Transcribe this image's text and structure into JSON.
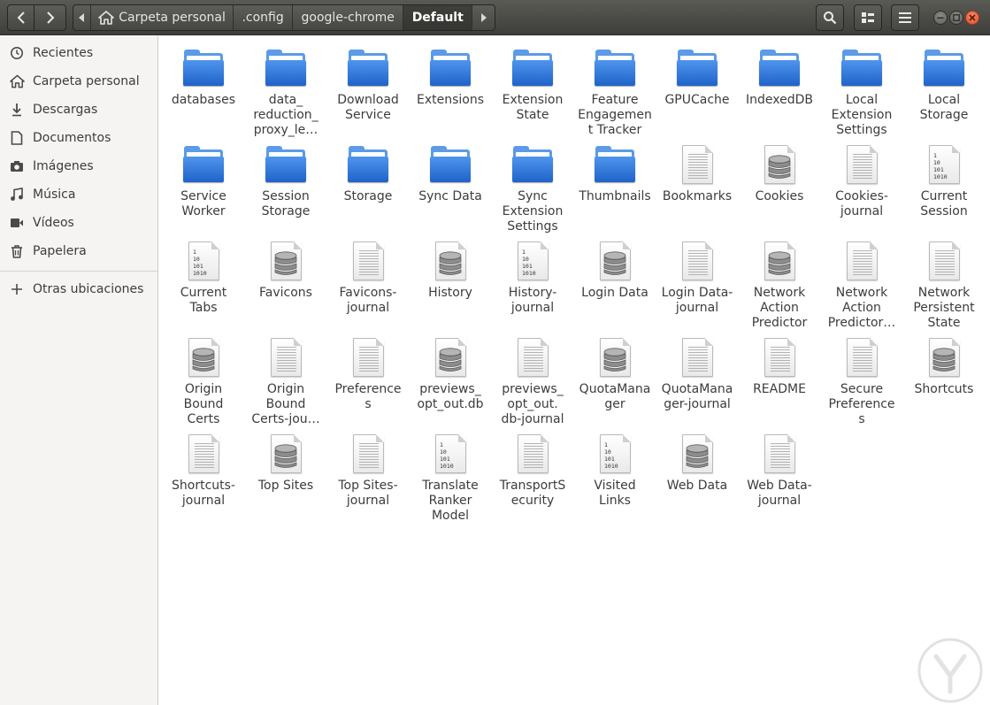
{
  "header": {
    "path": [
      ".config",
      "google-chrome"
    ],
    "home_label": "Carpeta personal",
    "current": "Default"
  },
  "sidebar": {
    "items": [
      {
        "label": "Recientes",
        "icon": "clock-icon"
      },
      {
        "label": "Carpeta personal",
        "icon": "home-icon"
      },
      {
        "label": "Descargas",
        "icon": "download-icon"
      },
      {
        "label": "Documentos",
        "icon": "document-icon"
      },
      {
        "label": "Imágenes",
        "icon": "camera-icon"
      },
      {
        "label": "Música",
        "icon": "music-icon"
      },
      {
        "label": "Vídeos",
        "icon": "film-icon"
      },
      {
        "label": "Papelera",
        "icon": "trash-icon"
      }
    ],
    "other_locations": "Otras ubicaciones"
  },
  "files": [
    {
      "name": "databases",
      "type": "folder"
    },
    {
      "name": "data_\nreduction_\nproxy_le…",
      "type": "folder"
    },
    {
      "name": "Download\nService",
      "type": "folder"
    },
    {
      "name": "Extensions",
      "type": "folder"
    },
    {
      "name": "Extension\nState",
      "type": "folder"
    },
    {
      "name": "Feature\nEngagemen\nt Tracker",
      "type": "folder"
    },
    {
      "name": "GPUCache",
      "type": "folder"
    },
    {
      "name": "IndexedDB",
      "type": "folder"
    },
    {
      "name": "Local\nExtension\nSettings",
      "type": "folder"
    },
    {
      "name": "Local\nStorage",
      "type": "folder"
    },
    {
      "name": "Service\nWorker",
      "type": "folder"
    },
    {
      "name": "Session\nStorage",
      "type": "folder"
    },
    {
      "name": "Storage",
      "type": "folder"
    },
    {
      "name": "Sync Data",
      "type": "folder"
    },
    {
      "name": "Sync\nExtension\nSettings",
      "type": "folder"
    },
    {
      "name": "Thumbnails",
      "type": "folder"
    },
    {
      "name": "Bookmarks",
      "type": "document"
    },
    {
      "name": "Cookies",
      "type": "database"
    },
    {
      "name": "Cookies-\njournal",
      "type": "document"
    },
    {
      "name": "Current\nSession",
      "type": "binary"
    },
    {
      "name": "Current\nTabs",
      "type": "binary"
    },
    {
      "name": "Favicons",
      "type": "database"
    },
    {
      "name": "Favicons-\njournal",
      "type": "document"
    },
    {
      "name": "History",
      "type": "database"
    },
    {
      "name": "History-\njournal",
      "type": "binary"
    },
    {
      "name": "Login Data",
      "type": "database"
    },
    {
      "name": "Login Data-\njournal",
      "type": "document"
    },
    {
      "name": "Network\nAction\nPredictor",
      "type": "database"
    },
    {
      "name": "Network\nAction\nPredictor…",
      "type": "document"
    },
    {
      "name": "Network\nPersistent\nState",
      "type": "document"
    },
    {
      "name": "Origin\nBound\nCerts",
      "type": "database"
    },
    {
      "name": "Origin\nBound\nCerts-jou…",
      "type": "document"
    },
    {
      "name": "Preference\ns",
      "type": "document"
    },
    {
      "name": "previews_\nopt_out.db",
      "type": "database"
    },
    {
      "name": "previews_\nopt_out.\ndb-journal",
      "type": "document"
    },
    {
      "name": "QuotaMana\nger",
      "type": "database"
    },
    {
      "name": "QuotaMana\nger-journal",
      "type": "document"
    },
    {
      "name": "README",
      "type": "document"
    },
    {
      "name": "Secure\nPreference\ns",
      "type": "document"
    },
    {
      "name": "Shortcuts",
      "type": "database"
    },
    {
      "name": "Shortcuts-\njournal",
      "type": "document"
    },
    {
      "name": "Top Sites",
      "type": "database"
    },
    {
      "name": "Top Sites-\njournal",
      "type": "document"
    },
    {
      "name": "Translate\nRanker\nModel",
      "type": "binary"
    },
    {
      "name": "TransportS\necurity",
      "type": "document"
    },
    {
      "name": "Visited\nLinks",
      "type": "binary"
    },
    {
      "name": "Web Data",
      "type": "database"
    },
    {
      "name": "Web Data-\njournal",
      "type": "document"
    }
  ],
  "binary_glyph": "1\n10\n101\n1010"
}
